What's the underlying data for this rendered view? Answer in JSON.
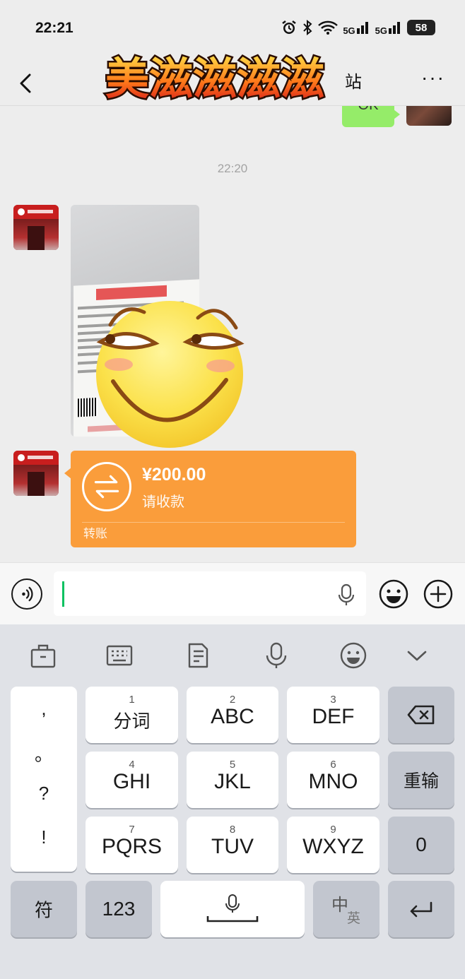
{
  "status_bar": {
    "time": "22:21",
    "signal_1": "5G",
    "signal_2": "5G",
    "battery": "58"
  },
  "header": {
    "title_visible": "站",
    "sticker_text": "美滋滋滋滋",
    "more": "···"
  },
  "chat": {
    "prev_bubble_text": "OK",
    "time_divider": "22:20",
    "transfer": {
      "amount": "¥200.00",
      "status": "请收款",
      "label": "转账"
    }
  },
  "input_bar": {
    "value": ""
  },
  "keyboard": {
    "punctuation": [
      ",",
      "。",
      "?",
      "!"
    ],
    "rows": [
      [
        {
          "num": "1",
          "label": "分词"
        },
        {
          "num": "2",
          "label": "ABC"
        },
        {
          "num": "3",
          "label": "DEF"
        }
      ],
      [
        {
          "num": "4",
          "label": "GHI"
        },
        {
          "num": "5",
          "label": "JKL"
        },
        {
          "num": "6",
          "label": "MNO"
        }
      ],
      [
        {
          "num": "7",
          "label": "PQRS"
        },
        {
          "num": "8",
          "label": "TUV"
        },
        {
          "num": "9",
          "label": "WXYZ"
        }
      ]
    ],
    "retype": "重输",
    "zero": "0",
    "symbols": "符",
    "numbers": "123",
    "lang_main": "中",
    "lang_sub": "英"
  },
  "colors": {
    "accent_green": "#07c160",
    "bubble_green": "#95ec69",
    "transfer_orange": "#fa9d3b"
  }
}
